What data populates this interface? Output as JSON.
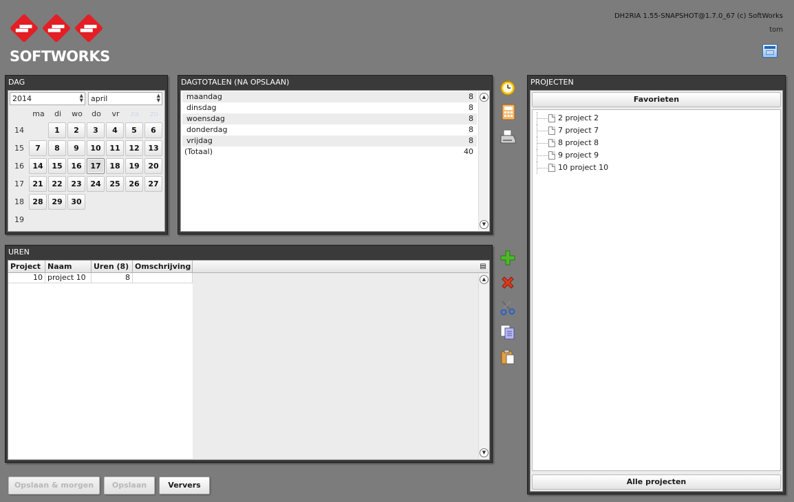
{
  "header": {
    "logo_text": "SOFTWORKS",
    "version": "DH2RIA 1.55-SNAPSHOT@1.7.0_67 (c) SoftWorks",
    "user": "tom"
  },
  "dag": {
    "title": "DAG",
    "year": "2014",
    "month": "april",
    "weekday_headers": [
      "ma",
      "di",
      "wo",
      "do",
      "vr",
      "za",
      "zo"
    ],
    "weeks": [
      {
        "week": "14",
        "days": [
          "",
          "1",
          "2",
          "3",
          "4",
          "5",
          "6"
        ]
      },
      {
        "week": "15",
        "days": [
          "7",
          "8",
          "9",
          "10",
          "11",
          "12",
          "13"
        ]
      },
      {
        "week": "16",
        "days": [
          "14",
          "15",
          "16",
          "17",
          "18",
          "19",
          "20"
        ]
      },
      {
        "week": "17",
        "days": [
          "21",
          "22",
          "23",
          "24",
          "25",
          "26",
          "27"
        ]
      },
      {
        "week": "18",
        "days": [
          "28",
          "29",
          "30",
          "",
          "",
          "",
          ""
        ]
      },
      {
        "week": "19",
        "days": [
          "",
          "",
          "",
          "",
          "",
          "",
          ""
        ]
      }
    ],
    "selected_day": "17"
  },
  "dagtotalen": {
    "title": "DAGTOTALEN (NA OPSLAAN)",
    "rows": [
      {
        "label": "maandag",
        "value": "8"
      },
      {
        "label": "dinsdag",
        "value": "8"
      },
      {
        "label": "woensdag",
        "value": "8"
      },
      {
        "label": "donderdag",
        "value": "8"
      },
      {
        "label": "vrijdag",
        "value": "8"
      },
      {
        "label": "(Totaal)",
        "value": "40"
      }
    ]
  },
  "uren": {
    "title": "UREN",
    "columns": [
      "Project",
      "Naam",
      "Uren (8)",
      "Omschrijving"
    ],
    "rows": [
      {
        "project": "10",
        "naam": "project 10",
        "uren": "8",
        "omschrijving": ""
      }
    ]
  },
  "projecten": {
    "title": "PROJECTEN",
    "favorites_label": "Favorieten",
    "items": [
      "2 project 2",
      "7 project 7",
      "8 project 8",
      "9 project 9",
      "10 project 10"
    ],
    "all_label": "Alle projecten"
  },
  "buttons": {
    "save_next": "Opslaan & morgen",
    "save": "Opslaan",
    "refresh": "Ververs"
  },
  "icons": {
    "timer": "stopwatch-icon",
    "calculator": "calculator-icon",
    "printer": "printer-icon",
    "add": "add-icon",
    "delete": "delete-icon",
    "cut": "scissors-icon",
    "copy": "copy-icon",
    "paste": "paste-icon"
  },
  "colors": {
    "background": "#7c7c7c",
    "panel": "#3a3a3a",
    "brand_red": "#e31e24"
  }
}
